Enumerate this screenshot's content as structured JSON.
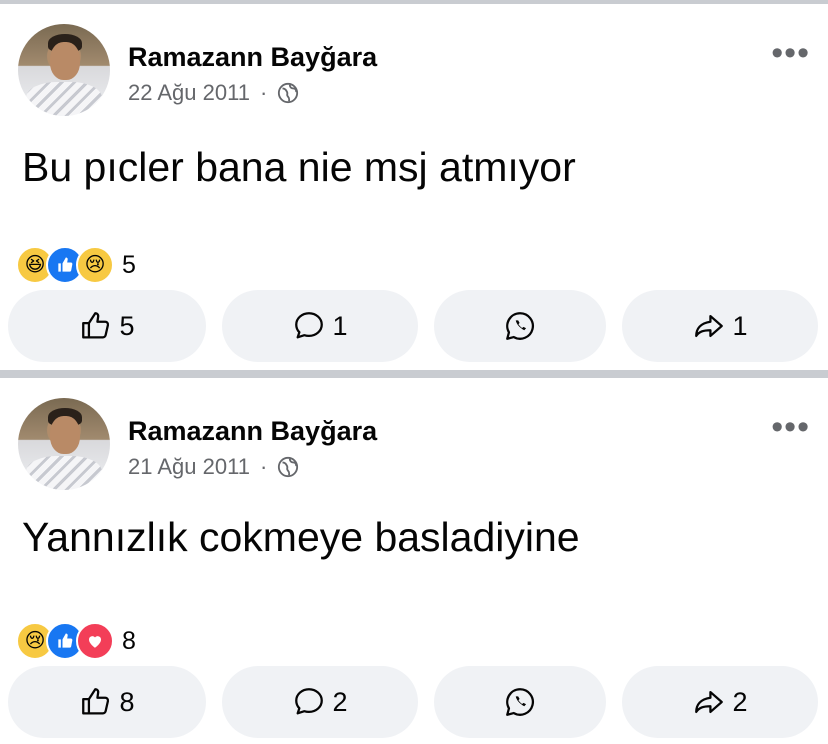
{
  "posts": [
    {
      "author": "Ramazann Bayğara",
      "date": "22 Ağu 2011",
      "separator": "·",
      "text": "Bu pıcler bana nie msj atmıyor",
      "reactions": [
        "haha-reaction-icon",
        "like-reaction-icon",
        "sad-reaction-icon"
      ],
      "reaction_count": "5",
      "like_count": "5",
      "comment_count": "1",
      "share_count": "1"
    },
    {
      "author": "Ramazann Bayğara",
      "date": "21 Ağu 2011",
      "separator": "·",
      "text": "Yannızlık cokmeye basladiyine",
      "reactions": [
        "sad-reaction-icon",
        "like-reaction-icon",
        "love-reaction-icon"
      ],
      "reaction_count": "8",
      "like_count": "8",
      "comment_count": "2",
      "share_count": "2"
    }
  ],
  "colors": {
    "divider": "#c9ccd1",
    "secondary_text": "#65676b",
    "button_bg": "#f0f2f5",
    "like_blue": "#1877f2",
    "love_red": "#f33e58",
    "emoji_yellow": "#f7c942"
  }
}
